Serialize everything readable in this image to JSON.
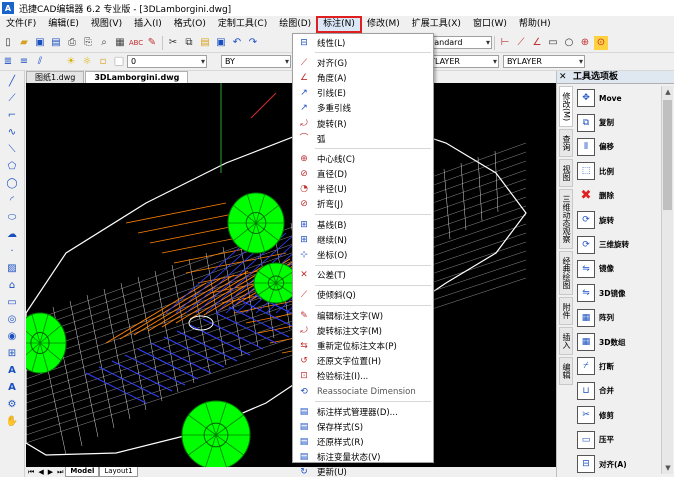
{
  "window": {
    "logo_text": "A",
    "title": "迅捷CAD编辑器 6.2 专业版 - [3DLamborgini.dwg]"
  },
  "menubar": {
    "items": [
      "文件(F)",
      "编辑(E)",
      "视图(V)",
      "插入(I)",
      "格式(O)",
      "定制工具(C)",
      "绘图(D)",
      "标注(N)",
      "修改(M)",
      "扩展工具(X)",
      "窗口(W)",
      "帮助(H)"
    ],
    "active_index": 7
  },
  "toolbar1": {
    "text_style": "Standard"
  },
  "toolbar2": {
    "layer": "0",
    "color": "BYLAYER",
    "linetype": "BYLAYER",
    "lineweight": "BYLAYER",
    "bylayer_short": "BY"
  },
  "doc_tabs": [
    "图纸1.dwg",
    "3DLamborgini.dwg"
  ],
  "layout_tabs": [
    "Model",
    "Layout1"
  ],
  "dimension_menu": {
    "items": [
      {
        "label": "线性(L)",
        "icon": "linear-dim-icon",
        "glyph": "⊟",
        "color": "#1a4fc0"
      },
      {
        "sep": true
      },
      {
        "label": "对齐(G)",
        "icon": "aligned-dim-icon",
        "glyph": "⟋",
        "color": "#c03030"
      },
      {
        "label": "角度(A)",
        "icon": "angular-dim-icon",
        "glyph": "∠",
        "color": "#c03030"
      },
      {
        "label": "引线(E)",
        "icon": "leader-icon",
        "glyph": "↗",
        "color": "#1a4fc0"
      },
      {
        "label": "多重引线",
        "icon": "multileader-icon",
        "glyph": "↗",
        "color": "#1a4fc0"
      },
      {
        "label": "旋转(R)",
        "icon": "rotated-dim-icon",
        "glyph": "⤾",
        "color": "#c03030"
      },
      {
        "label": "弧",
        "icon": "arc-dim-icon",
        "glyph": "⌒",
        "color": "#c03030"
      },
      {
        "sep": true
      },
      {
        "label": "中心线(C)",
        "icon": "centerline-icon",
        "glyph": "⊕",
        "color": "#c03030"
      },
      {
        "label": "直径(D)",
        "icon": "diameter-dim-icon",
        "glyph": "⊘",
        "color": "#c03030"
      },
      {
        "label": "半径(U)",
        "icon": "radius-dim-icon",
        "glyph": "◔",
        "color": "#c03030"
      },
      {
        "label": "折弯(J)",
        "icon": "jogged-dim-icon",
        "glyph": "⊘",
        "color": "#c03030"
      },
      {
        "sep": true
      },
      {
        "label": "基线(B)",
        "icon": "baseline-dim-icon",
        "glyph": "⊞",
        "color": "#1a4fc0"
      },
      {
        "label": "继续(N)",
        "icon": "continue-dim-icon",
        "glyph": "⊞",
        "color": "#1a4fc0"
      },
      {
        "label": "坐标(O)",
        "icon": "ordinate-dim-icon",
        "glyph": "⊹",
        "color": "#1a4fc0"
      },
      {
        "sep": true
      },
      {
        "label": "公差(T)",
        "icon": "tolerance-icon",
        "glyph": "✕",
        "color": "#c03030"
      },
      {
        "sep": true
      },
      {
        "label": "使倾斜(Q)",
        "icon": "oblique-icon",
        "glyph": "⟋",
        "color": "#c03030"
      },
      {
        "sep": true
      },
      {
        "label": "编辑标注文字(W)",
        "icon": "edit-dim-text-icon",
        "glyph": "✎",
        "color": "#c03030"
      },
      {
        "label": "旋转标注文字(M)",
        "icon": "rotate-dim-text-icon",
        "glyph": "⤾",
        "color": "#c03030"
      },
      {
        "label": "重新定位标注文本(P)",
        "icon": "reposition-dim-text-icon",
        "glyph": "⇆",
        "color": "#c03030"
      },
      {
        "label": "还原文字位置(H)",
        "icon": "restore-text-position-icon",
        "glyph": "↺",
        "color": "#c03030"
      },
      {
        "label": "检验标注(I)...",
        "icon": "inspect-dim-icon",
        "glyph": "⊡",
        "color": "#c03030"
      },
      {
        "label": "Reassociate Dimension",
        "icon": "reassociate-dim-icon",
        "glyph": "⟲",
        "color": "#1a4fc0",
        "gray": true
      },
      {
        "sep": true
      },
      {
        "label": "标注样式管理器(D)...",
        "icon": "dim-style-manager-icon",
        "glyph": "▤",
        "color": "#1a4fc0"
      },
      {
        "label": "保存样式(S)",
        "icon": "save-style-icon",
        "glyph": "▤",
        "color": "#1a4fc0"
      },
      {
        "label": "还原样式(R)",
        "icon": "restore-style-icon",
        "glyph": "▤",
        "color": "#1a4fc0"
      },
      {
        "label": "标注变量状态(V)",
        "icon": "dim-variable-status-icon",
        "glyph": "▤",
        "color": "#1a4fc0"
      },
      {
        "label": "更新(U)",
        "icon": "update-icon",
        "glyph": "↻",
        "color": "#1a4fc0"
      }
    ]
  },
  "tool_palette": {
    "title": "工具选项板",
    "tabs": [
      "修改(M)",
      "查询",
      "视图",
      "三维动态观察",
      "经典绘图",
      "附件",
      "插入",
      "编辑"
    ],
    "active_tab": 0,
    "tools": [
      {
        "label": "Move",
        "icon": "move-icon",
        "glyph": "✥"
      },
      {
        "label": "复制",
        "icon": "copy-icon",
        "glyph": "⧉"
      },
      {
        "label": "偏移",
        "icon": "offset-icon",
        "glyph": "⫴"
      },
      {
        "label": "比例",
        "icon": "scale-icon",
        "glyph": "⬚"
      },
      {
        "label": "删除",
        "icon": "erase-icon",
        "glyph": "✖"
      },
      {
        "label": "旋转",
        "icon": "rotate-icon",
        "glyph": "⟳"
      },
      {
        "label": "三维旋转",
        "icon": "rotate-3d-icon",
        "glyph": "⟳"
      },
      {
        "label": "镜像",
        "icon": "mirror-icon",
        "glyph": "⇋"
      },
      {
        "label": "3D镜像",
        "icon": "mirror-3d-icon",
        "glyph": "⇋"
      },
      {
        "label": "阵列",
        "icon": "array-icon",
        "glyph": "▦"
      },
      {
        "label": "3D数组",
        "icon": "array-3d-icon",
        "glyph": "▦"
      },
      {
        "label": "打断",
        "icon": "break-icon",
        "glyph": "⌿"
      },
      {
        "label": "合并",
        "icon": "join-icon",
        "glyph": "⊔"
      },
      {
        "label": "修剪",
        "icon": "trim-icon",
        "glyph": "✂"
      },
      {
        "label": "压平",
        "icon": "flatten-icon",
        "glyph": "▭"
      },
      {
        "label": "对齐(A)",
        "icon": "align-icon",
        "glyph": "⊟"
      }
    ]
  },
  "colors": {
    "accent": "#e02020",
    "canvas": "#000000",
    "wire_white": "#ffffff",
    "wire_orange": "#ff8000",
    "wire_blue": "#3040ff",
    "wheel_green": "#00ff00"
  }
}
